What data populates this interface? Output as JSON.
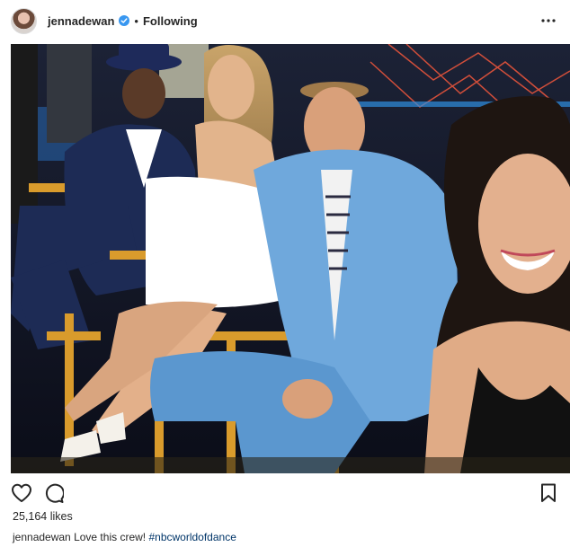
{
  "header": {
    "username": "jennadewan",
    "separator": "•",
    "follow_state": "Following",
    "verified_icon": "verified-badge-icon",
    "more_icon": "more-options-icon"
  },
  "photo": {
    "description_icon": "post-photo"
  },
  "actions": {
    "like_icon": "heart-icon",
    "comment_icon": "comment-icon",
    "save_icon": "bookmark-icon"
  },
  "likes": {
    "count_text": "25,164 likes"
  },
  "caption": {
    "username": "jennadewan",
    "text": "Love this crew!",
    "hashtag": "#nbcworldofdance"
  },
  "colors": {
    "text": "#262626",
    "verified": "#3897f0",
    "hashtag": "#003569",
    "suit_blue": "#6fa8dc"
  }
}
